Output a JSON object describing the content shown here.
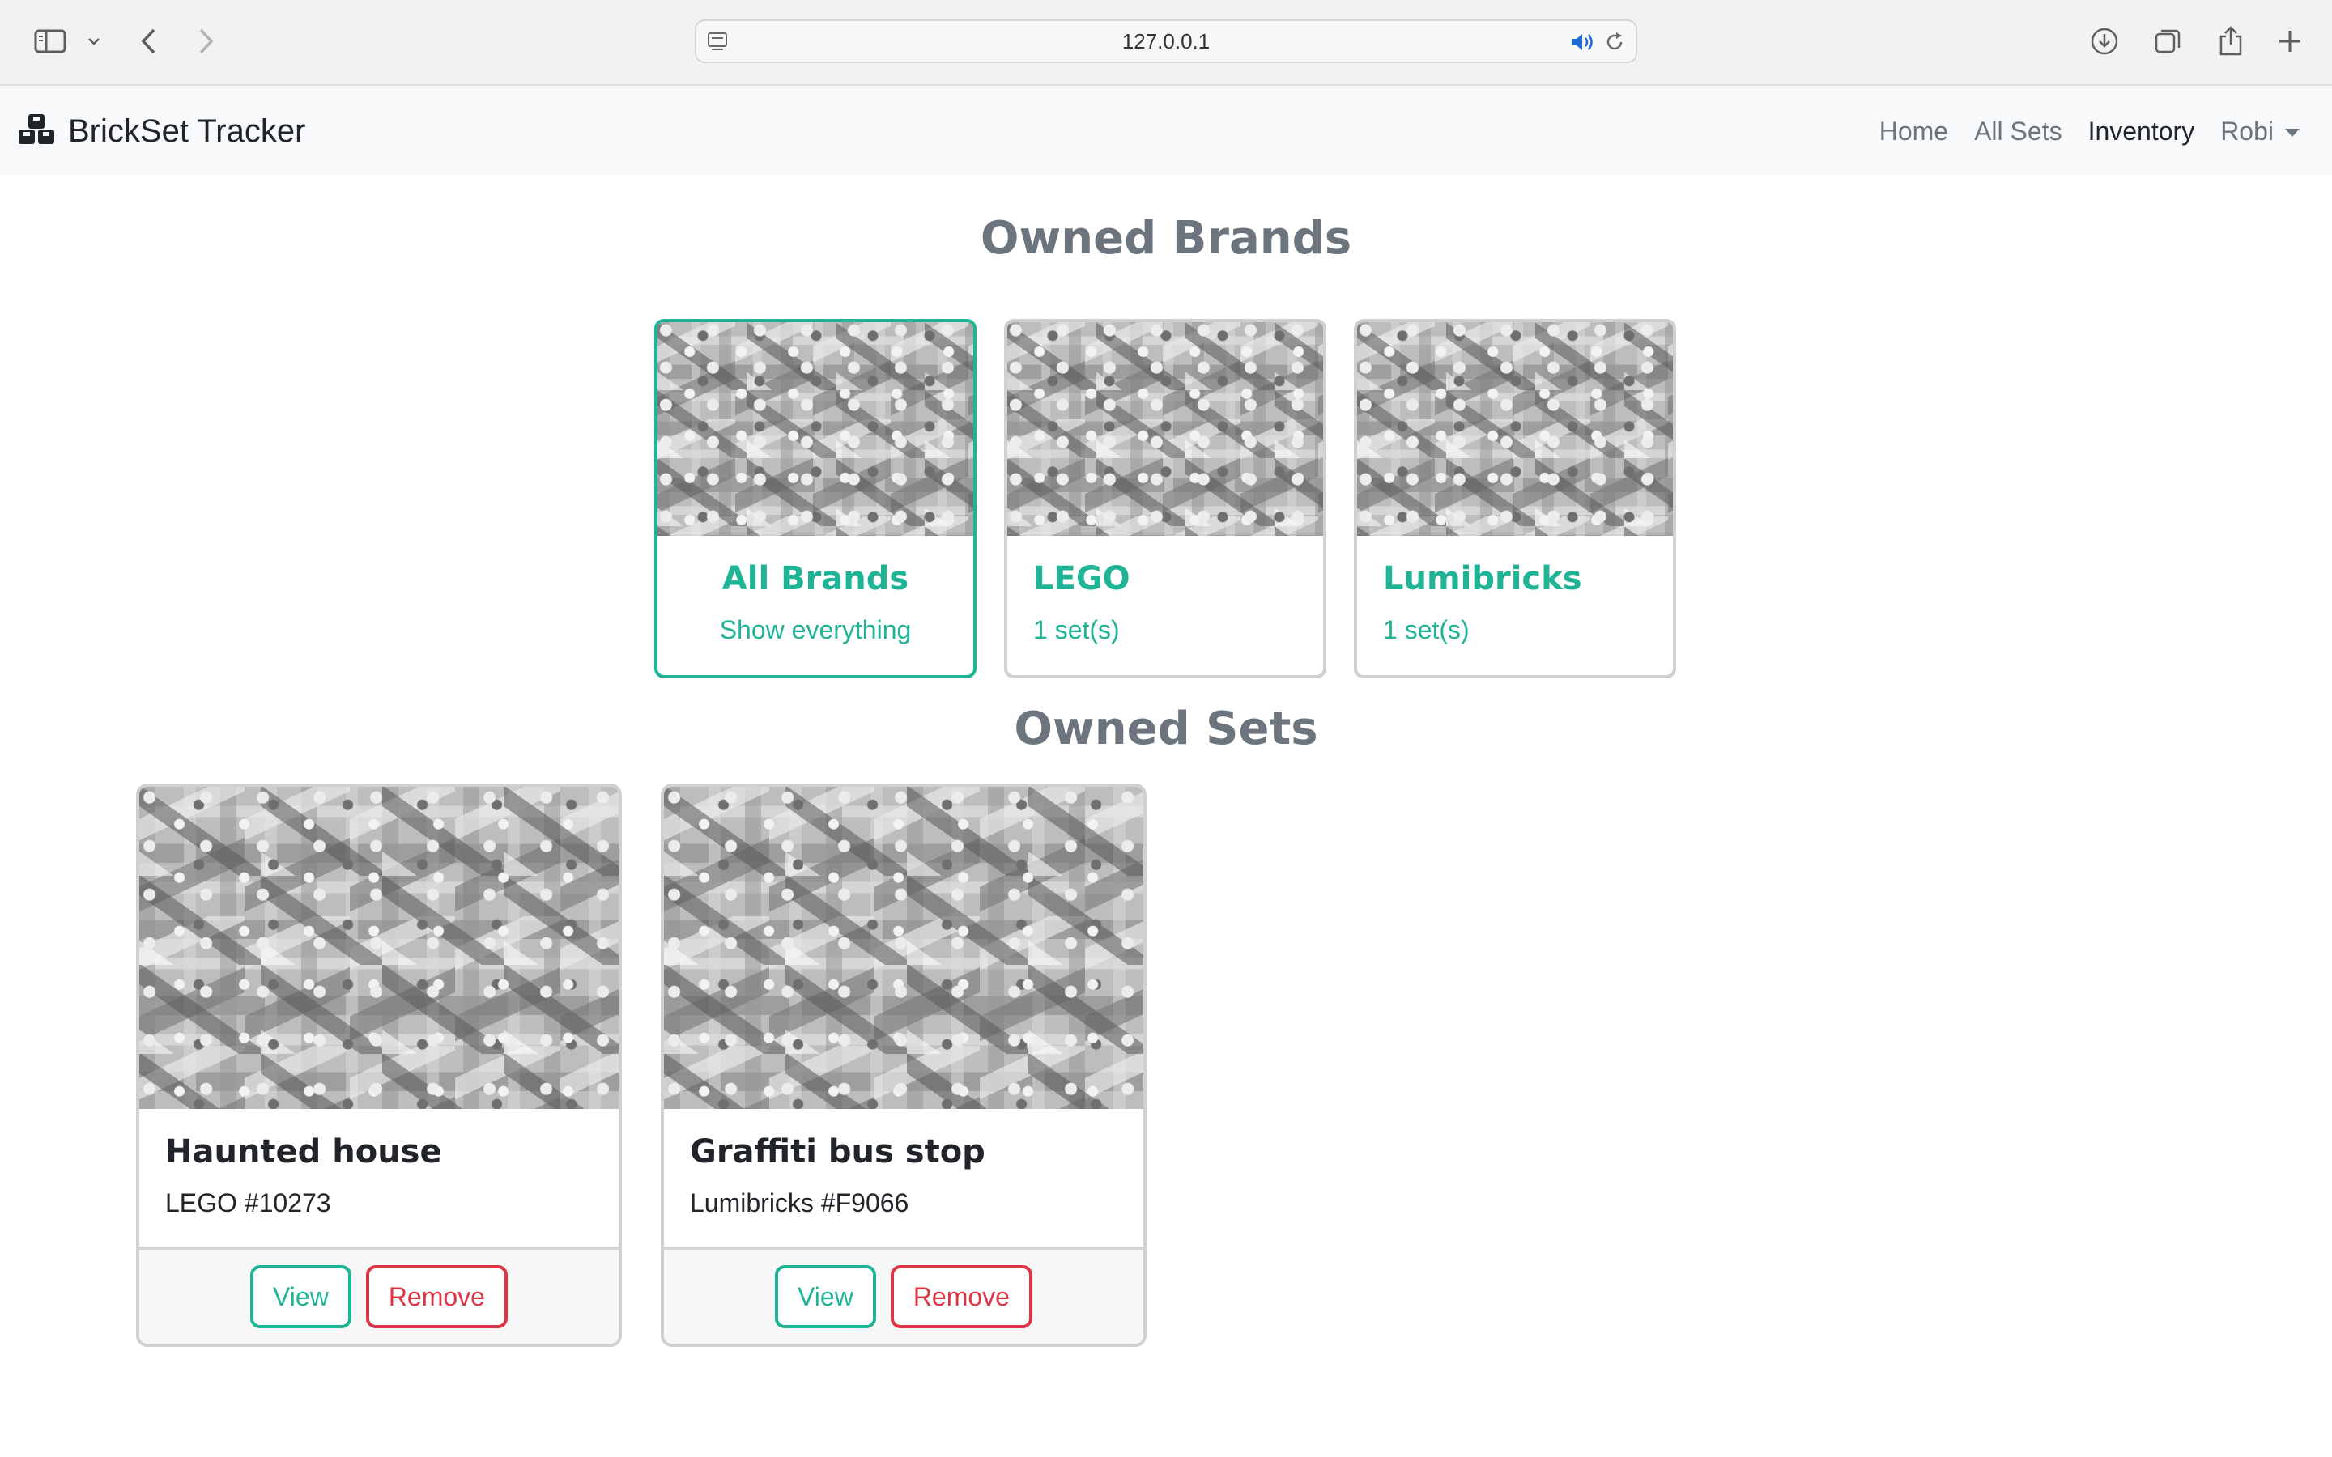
{
  "browser": {
    "url": "127.0.0.1",
    "icons": [
      "sidebar-icon",
      "chevron-down-icon",
      "back-icon",
      "forward-icon",
      "page-icon",
      "speaker-icon",
      "reload-icon",
      "download-icon",
      "tabs-icon",
      "share-icon",
      "new-tab-icon"
    ]
  },
  "navbar": {
    "brand_title": "BrickSet Tracker",
    "links": [
      {
        "label": "Home"
      },
      {
        "label": "All Sets"
      },
      {
        "label": "Inventory"
      },
      {
        "label": "Robi"
      }
    ]
  },
  "brands_section": {
    "title": "Owned Brands",
    "cards": [
      {
        "name": "All Brands",
        "subtitle": "Show everything",
        "selected": true
      },
      {
        "name": "LEGO",
        "subtitle": "1 set(s)",
        "selected": false
      },
      {
        "name": "Lumibricks",
        "subtitle": "1 set(s)",
        "selected": false
      }
    ]
  },
  "sets_section": {
    "title": "Owned Sets",
    "cards": [
      {
        "title": "Haunted house",
        "meta": "LEGO #10273",
        "view_label": "View",
        "remove_label": "Remove"
      },
      {
        "title": "Graffiti bus stop",
        "meta": "Lumibricks #F9066",
        "view_label": "View",
        "remove_label": "Remove"
      }
    ]
  },
  "colors": {
    "accent": "#20b497",
    "danger": "#dc3545",
    "heading": "#6c757d",
    "navbar_bg": "#f8f9fa"
  }
}
